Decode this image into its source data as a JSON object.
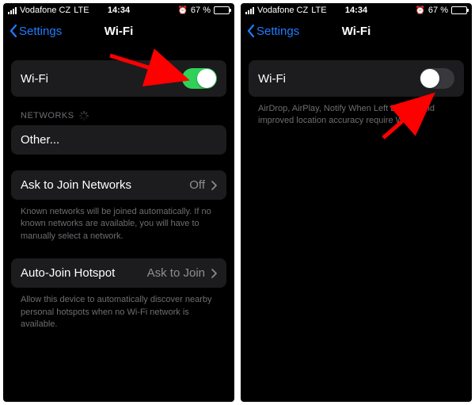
{
  "status": {
    "carrier": "Vodafone CZ",
    "network": "LTE",
    "time": "14:34",
    "alarm_icon": "⏰",
    "battery_pct": "67 %",
    "battery_fill": 67
  },
  "nav": {
    "back_label": "Settings",
    "title": "Wi-Fi"
  },
  "left_screen": {
    "wifi_label": "Wi-Fi",
    "wifi_on": true,
    "networks_header": "NETWORKS",
    "other_label": "Other...",
    "ask_join_label": "Ask to Join Networks",
    "ask_join_value": "Off",
    "ask_join_footer": "Known networks will be joined automatically. If no known networks are available, you will have to manually select a network.",
    "autojoin_label": "Auto-Join Hotspot",
    "autojoin_value": "Ask to Join",
    "autojoin_footer": "Allow this device to automatically discover nearby personal hotspots when no Wi-Fi network is available."
  },
  "right_screen": {
    "wifi_label": "Wi-Fi",
    "wifi_on": false,
    "footer": "AirDrop, AirPlay, Notify When Left Behind and improved location accuracy require Wi-Fi."
  },
  "annotation": {
    "color": "#ff0000"
  }
}
